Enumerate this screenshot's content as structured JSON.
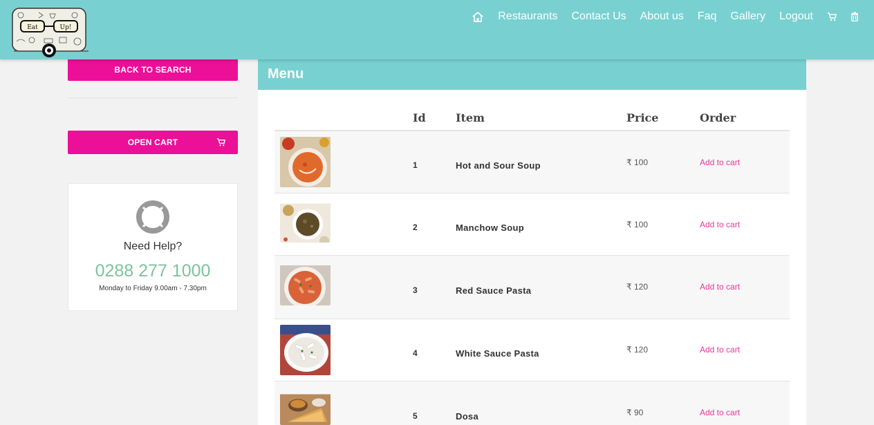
{
  "logo": {
    "left_text": "Eat",
    "right_text": "Up!"
  },
  "nav": {
    "home_icon": "home-icon",
    "items": [
      "Restaurants",
      "Contact Us",
      "About us",
      "Faq",
      "Gallery",
      "Logout"
    ],
    "cart_icon": "cart-icon",
    "trash_icon": "trash-icon"
  },
  "sidebar": {
    "back_label": "BACK TO SEARCH",
    "cart_label": "OPEN CART",
    "help": {
      "icon": "lifebuoy-icon",
      "title": "Need Help?",
      "phone": "0288 277 1000",
      "hours": "Monday to Friday 9.00am - 7.30pm"
    }
  },
  "menu": {
    "title": "Menu",
    "columns": {
      "id": "Id",
      "item": "Item",
      "price": "Price",
      "order": "Order"
    },
    "rows": [
      {
        "id": "1",
        "item": "Hot and Sour Soup",
        "price": "₹ 100",
        "order": "Add to cart",
        "image": "soup"
      },
      {
        "id": "2",
        "item": "Manchow Soup",
        "price": "₹ 100",
        "order": "Add to cart",
        "image": "bowl"
      },
      {
        "id": "3",
        "item": "Red Sauce Pasta",
        "price": "₹ 120",
        "order": "Add to cart",
        "image": "red-pasta"
      },
      {
        "id": "4",
        "item": "White Sauce Pasta",
        "price": "₹ 120",
        "order": "Add to cart",
        "image": "white-pasta"
      },
      {
        "id": "5",
        "item": "Dosa",
        "price": "₹ 90",
        "order": "Add to cart",
        "image": "dosa"
      }
    ]
  },
  "colors": {
    "teal": "#79d0d1",
    "pink": "#ec0f98",
    "phone_green": "#7cc49a",
    "link_pink": "#e8359c"
  }
}
